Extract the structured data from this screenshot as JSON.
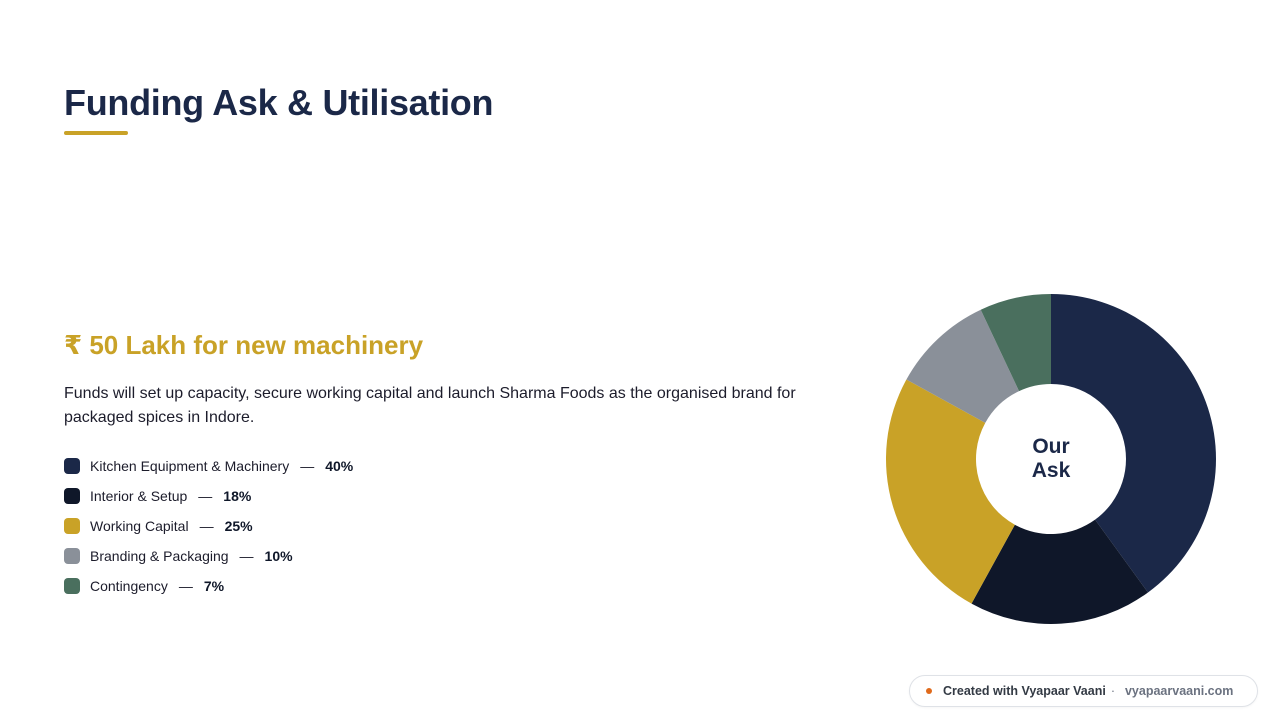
{
  "page": {
    "title": "Funding Ask & Utilisation",
    "ask_heading": "₹ 50 Lakh for new machinery",
    "description": "Funds will set up capacity, secure working capital and launch Sharma Foods as the organised brand for packaged spices in Indore.",
    "legend_dash": "—"
  },
  "colors": {
    "title": "#1b2848",
    "accent": "#c9a227"
  },
  "chart_data": {
    "type": "pie",
    "donut": true,
    "center_label": [
      "Our",
      "Ask"
    ],
    "categories": [
      "Kitchen Equipment & Machinery",
      "Interior & Setup",
      "Working Capital",
      "Branding & Packaging",
      "Contingency"
    ],
    "values": [
      40,
      18,
      25,
      10,
      7
    ],
    "value_labels": [
      "40%",
      "18%",
      "25%",
      "10%",
      "7%"
    ],
    "colors": [
      "#1b2848",
      "#0f1729",
      "#c9a227",
      "#8a9099",
      "#4a6f5e"
    ],
    "legend_placement": "left"
  },
  "footer": {
    "created_text": "Created with Vyapaar Vaani",
    "separator": "·",
    "site": "vyapaarvaani.com"
  }
}
